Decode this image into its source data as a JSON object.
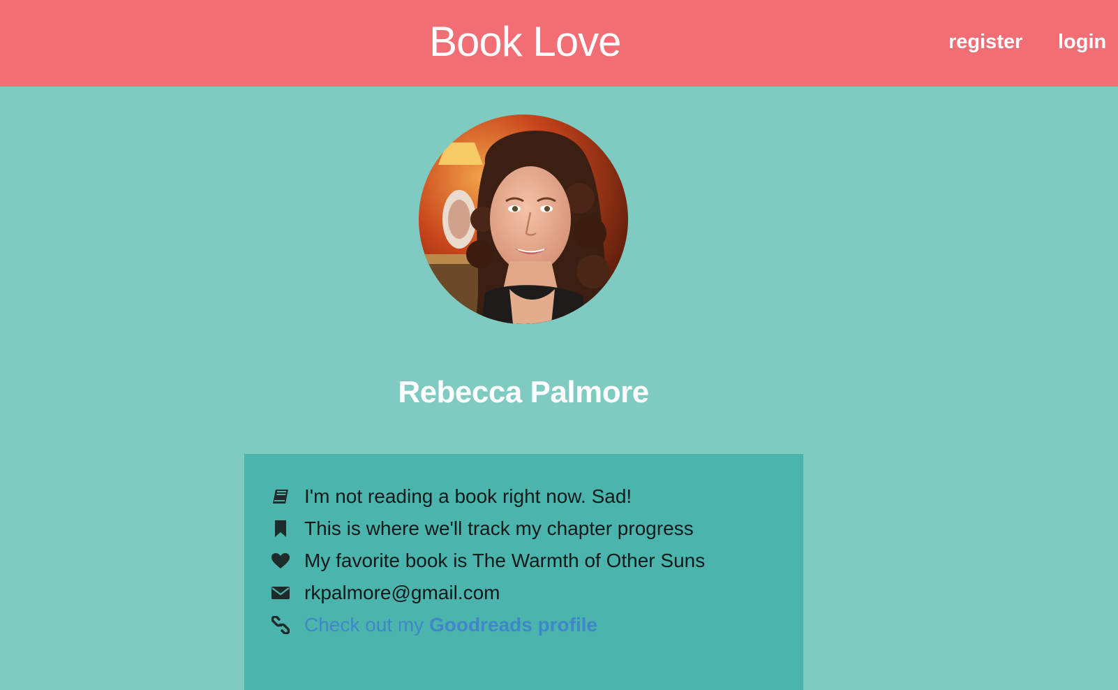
{
  "header": {
    "brand": "Book Love",
    "nav": {
      "register": "register",
      "login": "login"
    },
    "background_color": "#f06e74"
  },
  "page": {
    "background_color": "#7fcbc1"
  },
  "profile": {
    "avatar_icon": "profile-photo",
    "name": "Rebecca Palmore"
  },
  "info_card": {
    "background_color": "#4bb4ac",
    "items": [
      {
        "icon": "book-icon",
        "text": "I'm not reading a book right now. Sad!"
      },
      {
        "icon": "bookmark-icon",
        "text": "This is where we'll track my chapter progress"
      },
      {
        "icon": "heart-icon",
        "text": "My favorite book is The Warmth of Other Suns"
      },
      {
        "icon": "envelope-icon",
        "text": "rkpalmore@gmail.com"
      }
    ],
    "goodreads": {
      "icon": "link-icon",
      "prefix": "Check out my ",
      "link_text": "Goodreads profile",
      "color": "#3f87c9"
    }
  }
}
